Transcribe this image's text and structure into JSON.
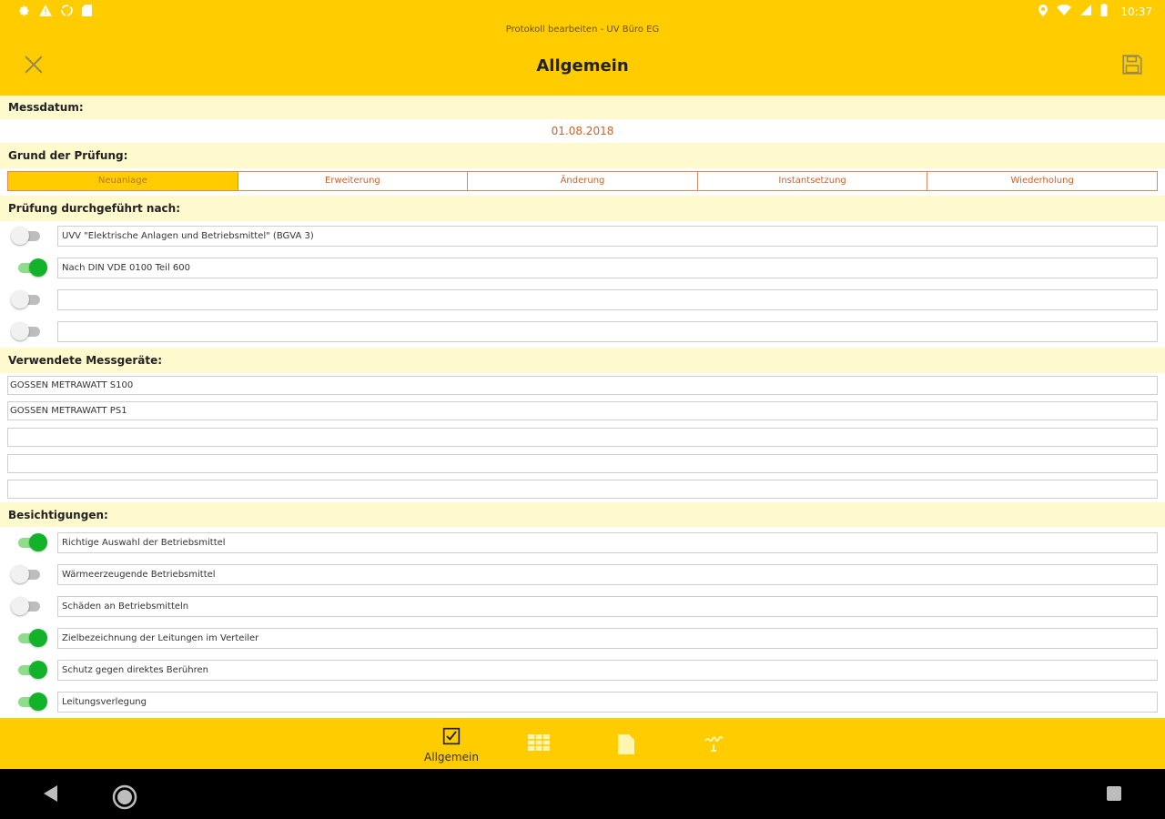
{
  "status_bar": {
    "time": "10:37",
    "left_icons": [
      "gear-icon",
      "warning-icon",
      "sync-icon",
      "sd-card-icon"
    ],
    "right_icons": [
      "location-icon",
      "wifi-icon",
      "signal-icon",
      "battery-icon"
    ]
  },
  "app_bar": {
    "subtitle": "Protokoll bearbeiten - UV Büro EG",
    "title": "Allgemein",
    "close_icon": "close-icon",
    "save_icon": "save-icon"
  },
  "sections": {
    "messdatum": {
      "label": "Messdatum:",
      "value": "01.08.2018"
    },
    "grund": {
      "label": "Grund der Prüfung:",
      "options": [
        "Neuanlage",
        "Erweiterung",
        "Änderung",
        "Instantsetzung",
        "Wiederholung"
      ],
      "selected": "Neuanlage"
    },
    "durchgefuehrt": {
      "label": "Prüfung durchgeführt nach:",
      "rows": [
        {
          "on": false,
          "text": "UVV \"Elektrische Anlagen und Betriebsmittel\" (BGVA 3)"
        },
        {
          "on": true,
          "text": "Nach DIN VDE 0100 Teil 600"
        },
        {
          "on": false,
          "text": ""
        },
        {
          "on": false,
          "text": ""
        }
      ]
    },
    "messgeraete": {
      "label": "Verwendete Messgeräte:",
      "rows": [
        "GOSSEN METRAWATT S100",
        "GOSSEN METRAWATT PS1",
        "",
        "",
        ""
      ]
    },
    "besichtigungen": {
      "label": "Besichtigungen:",
      "rows": [
        {
          "on": true,
          "text": "Richtige Auswahl der Betriebsmittel"
        },
        {
          "on": false,
          "text": "Wärmeerzeugende Betriebsmittel"
        },
        {
          "on": false,
          "text": "Schäden an Betriebsmitteln"
        },
        {
          "on": true,
          "text": "Zielbezeichnung der Leitungen im Verteiler"
        },
        {
          "on": true,
          "text": "Schutz gegen direktes Berühren"
        },
        {
          "on": true,
          "text": "Leitungsverlegung"
        }
      ]
    }
  },
  "bottom_nav": {
    "items": [
      {
        "icon": "checkbox-icon",
        "label": "Allgemein"
      },
      {
        "icon": "table-icon",
        "label": ""
      },
      {
        "icon": "document-icon",
        "label": ""
      },
      {
        "icon": "signature-icon",
        "label": ""
      }
    ]
  },
  "system_nav": {
    "icons": [
      "back-icon",
      "home-icon",
      "recents-icon"
    ]
  },
  "colors": {
    "accent": "#FFCC00",
    "section_bg": "#FFFACD",
    "date_text": "#C8642C",
    "toggle_on": "#12B22A",
    "toggle_off": "#F1F1F1"
  }
}
